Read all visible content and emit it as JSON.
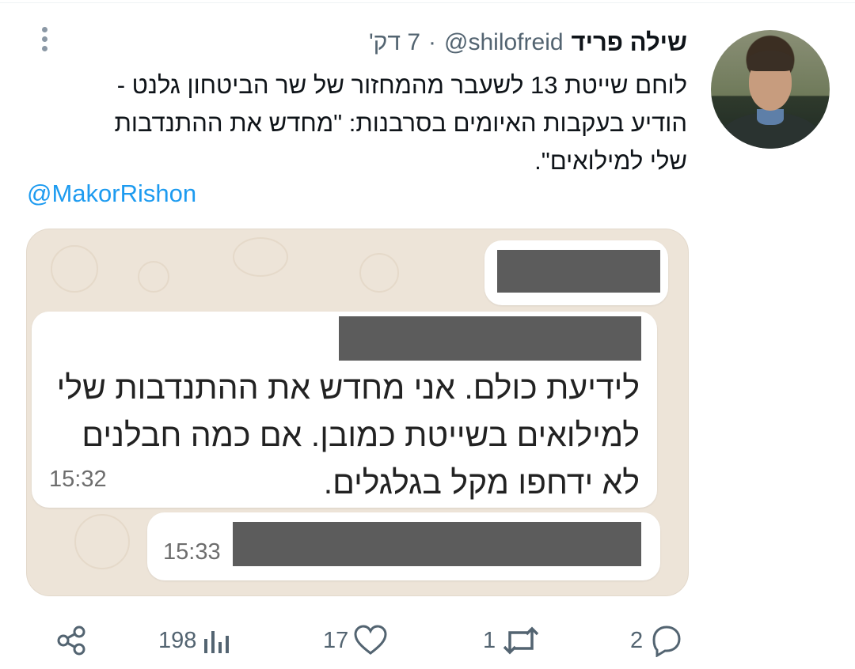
{
  "tweet": {
    "author_name": "שילה פריד",
    "handle": "@shilofreid",
    "separator": "·",
    "time": "7 דק'",
    "text_lines": [
      "לוחם שייטת 13 לשעבר מהמחזור של שר הביטחון גלנט -",
      "הודיע בעקבות האיומים בסרבנות: \"מחדש את ההתנדבות",
      "שלי למילואים\"."
    ],
    "mention": "@MakorRishon"
  },
  "media": {
    "message_lines": [
      "לידיעת כולם. אני מחדש את ההתנדבות שלי",
      "למילואים בשייטת כמובן. אם כמה חבלנים",
      "לא ידחפו מקל בגלגלים."
    ],
    "message_time": "15:32",
    "reply_time": "15:33"
  },
  "actions": {
    "views": "198",
    "likes": "17",
    "retweets": "1",
    "replies": "2"
  },
  "colors": {
    "link": "#1d9bf0",
    "secondary_text": "#536471",
    "chat_background": "#ede4d8",
    "redaction": "#5c5c5c"
  },
  "icons": [
    "more-icon",
    "share-icon",
    "views-icon",
    "like-icon",
    "retweet-icon",
    "reply-icon"
  ]
}
